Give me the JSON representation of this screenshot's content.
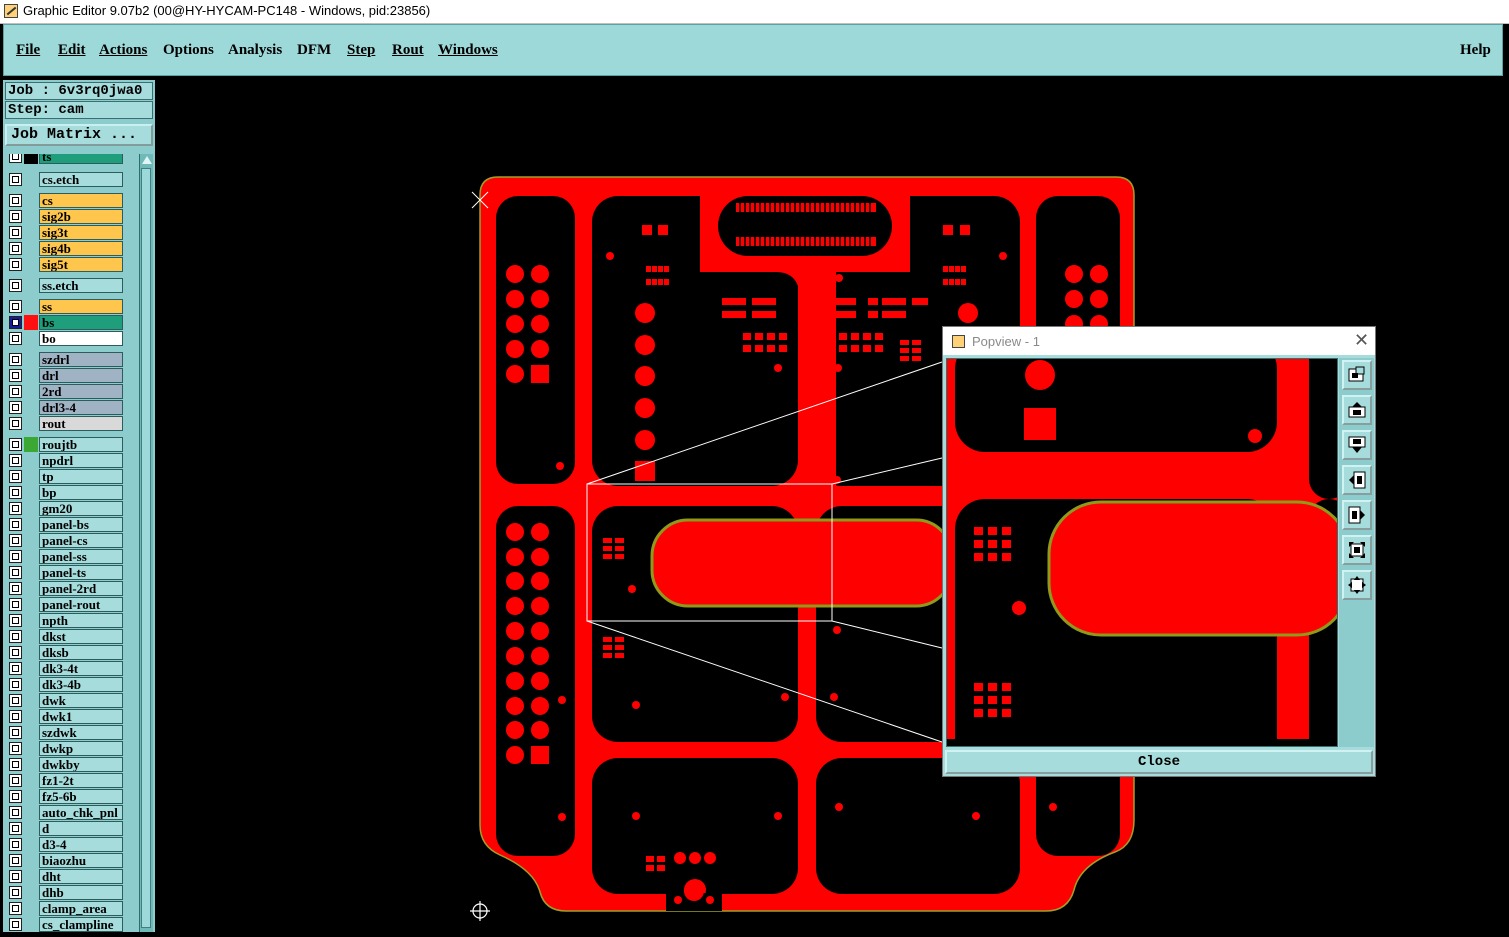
{
  "window": {
    "title": "Graphic Editor 9.07b2 (00@HY-HYCAM-PC148 - Windows, pid:23856)"
  },
  "menu": {
    "items": [
      {
        "label": "File"
      },
      {
        "label": "Edit"
      },
      {
        "label": "Actions"
      },
      {
        "label": "Options"
      },
      {
        "label": "Analysis"
      },
      {
        "label": "DFM"
      },
      {
        "label": "Step"
      },
      {
        "label": "Rout"
      },
      {
        "label": "Windows"
      }
    ],
    "help": "Help"
  },
  "info": {
    "job": "Job : 6v3rq0jwa0",
    "step": "Step: cam",
    "job_matrix": "Job Matrix ..."
  },
  "layers": [
    {
      "name": "ts",
      "color": "#1e9e7a",
      "swatch": "#000000",
      "sel": false
    },
    {
      "name": "cs.etch",
      "color": "#a6dcdc",
      "swatch": "",
      "sel": false
    },
    {
      "name": "cs",
      "color": "#ffc64d",
      "swatch": "",
      "sel": false
    },
    {
      "name": "sig2b",
      "color": "#ffc64d",
      "swatch": "",
      "sel": false
    },
    {
      "name": "sig3t",
      "color": "#ffc64d",
      "swatch": "",
      "sel": false
    },
    {
      "name": "sig4b",
      "color": "#ffc64d",
      "swatch": "",
      "sel": false
    },
    {
      "name": "sig5t",
      "color": "#ffc64d",
      "swatch": "",
      "sel": false
    },
    {
      "name": "ss.etch",
      "color": "#a6dcdc",
      "swatch": "",
      "sel": false
    },
    {
      "name": "ss",
      "color": "#ffc64d",
      "swatch": "",
      "sel": false
    },
    {
      "name": "bs",
      "color": "#1e9e7a",
      "swatch": "#ff1010",
      "sel": true
    },
    {
      "name": "bo",
      "color": "#ffffff",
      "swatch": "",
      "sel": false
    },
    {
      "name": "szdrl",
      "color": "#9fb3c4",
      "swatch": "",
      "sel": false
    },
    {
      "name": "drl",
      "color": "#9fb3c4",
      "swatch": "",
      "sel": false
    },
    {
      "name": "2rd",
      "color": "#9fb3c4",
      "swatch": "",
      "sel": false
    },
    {
      "name": "drl3-4",
      "color": "#9fb3c4",
      "swatch": "",
      "sel": false
    },
    {
      "name": "rout",
      "color": "#d9d9d9",
      "swatch": "",
      "sel": false
    },
    {
      "name": "roujtb",
      "color": "#a6dcdc",
      "swatch": "#3aa832",
      "sel": false
    },
    {
      "name": "npdrl",
      "color": "#a6dcdc",
      "swatch": "",
      "sel": false
    },
    {
      "name": "tp",
      "color": "#a6dcdc",
      "swatch": "",
      "sel": false
    },
    {
      "name": "bp",
      "color": "#a6dcdc",
      "swatch": "",
      "sel": false
    },
    {
      "name": "gm20",
      "color": "#a6dcdc",
      "swatch": "",
      "sel": false
    },
    {
      "name": "panel-bs",
      "color": "#a6dcdc",
      "swatch": "",
      "sel": false
    },
    {
      "name": "panel-cs",
      "color": "#a6dcdc",
      "swatch": "",
      "sel": false
    },
    {
      "name": "panel-ss",
      "color": "#a6dcdc",
      "swatch": "",
      "sel": false
    },
    {
      "name": "panel-ts",
      "color": "#a6dcdc",
      "swatch": "",
      "sel": false
    },
    {
      "name": "panel-2rd",
      "color": "#a6dcdc",
      "swatch": "",
      "sel": false
    },
    {
      "name": "panel-rout",
      "color": "#a6dcdc",
      "swatch": "",
      "sel": false
    },
    {
      "name": "npth",
      "color": "#a6dcdc",
      "swatch": "",
      "sel": false
    },
    {
      "name": "dkst",
      "color": "#a6dcdc",
      "swatch": "",
      "sel": false
    },
    {
      "name": "dksb",
      "color": "#a6dcdc",
      "swatch": "",
      "sel": false
    },
    {
      "name": "dk3-4t",
      "color": "#a6dcdc",
      "swatch": "",
      "sel": false
    },
    {
      "name": "dk3-4b",
      "color": "#a6dcdc",
      "swatch": "",
      "sel": false
    },
    {
      "name": "dwk",
      "color": "#a6dcdc",
      "swatch": "",
      "sel": false
    },
    {
      "name": "dwk1",
      "color": "#a6dcdc",
      "swatch": "",
      "sel": false
    },
    {
      "name": "szdwk",
      "color": "#a6dcdc",
      "swatch": "",
      "sel": false
    },
    {
      "name": "dwkp",
      "color": "#a6dcdc",
      "swatch": "",
      "sel": false
    },
    {
      "name": "dwkby",
      "color": "#a6dcdc",
      "swatch": "",
      "sel": false
    },
    {
      "name": "fz1-2t",
      "color": "#a6dcdc",
      "swatch": "",
      "sel": false
    },
    {
      "name": "fz5-6b",
      "color": "#a6dcdc",
      "swatch": "",
      "sel": false
    },
    {
      "name": "auto_chk_pnl",
      "color": "#a6dcdc",
      "swatch": "",
      "sel": false
    },
    {
      "name": "d",
      "color": "#a6dcdc",
      "swatch": "",
      "sel": false
    },
    {
      "name": "d3-4",
      "color": "#a6dcdc",
      "swatch": "",
      "sel": false
    },
    {
      "name": "biaozhu",
      "color": "#a6dcdc",
      "swatch": "",
      "sel": false
    },
    {
      "name": "dht",
      "color": "#a6dcdc",
      "swatch": "",
      "sel": false
    },
    {
      "name": "dhb",
      "color": "#a6dcdc",
      "swatch": "",
      "sel": false
    },
    {
      "name": "clamp_area",
      "color": "#a6dcdc",
      "swatch": "",
      "sel": false
    },
    {
      "name": "cs_clampline",
      "color": "#a6dcdc",
      "swatch": "",
      "sel": false
    }
  ],
  "colors": {
    "copper": "#ff0000",
    "outline": "#8f9a1a",
    "panel_bg": "#a6dcdc",
    "canvas_bg": "#000000"
  },
  "popview": {
    "title": "Popview - 1",
    "close_label": "Close",
    "tools": [
      {
        "icon": "zoom-window-icon"
      },
      {
        "icon": "zoom-in-icon"
      },
      {
        "icon": "zoom-out-icon"
      },
      {
        "icon": "pan-left-icon"
      },
      {
        "icon": "pan-right-icon"
      },
      {
        "icon": "fit-all-icon"
      },
      {
        "icon": "fit-center-icon"
      }
    ]
  }
}
